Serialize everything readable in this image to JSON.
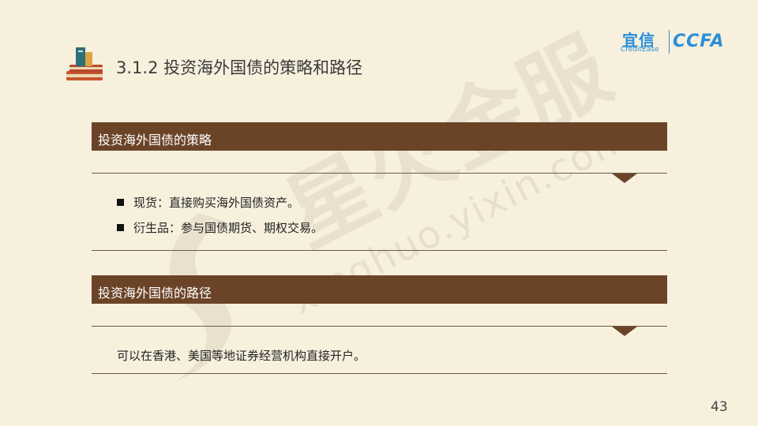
{
  "header": {
    "title": "3.1.2 投资海外国债的策略和路径"
  },
  "logos": {
    "yixin_cn": "宜信",
    "yixin_en": "CreditEase",
    "ccfa": "CCFA"
  },
  "watermark": {
    "cn": "星火金服",
    "en": "xinghuo.yixin.com"
  },
  "sections": [
    {
      "heading": "投资海外国债的策略",
      "bullets": [
        "现货：直接购买海外国债资产。",
        "衍生品：参与国债期货、期权交易。"
      ]
    },
    {
      "heading": "投资海外国债的路径",
      "text": "可以在香港、美国等地证券经营机构直接开户。"
    }
  ],
  "footer": {
    "page_number": "43"
  },
  "colors": {
    "background": "#f7f0dd",
    "bar": "#6b4428",
    "brand_blue": "#2a8fd8"
  }
}
